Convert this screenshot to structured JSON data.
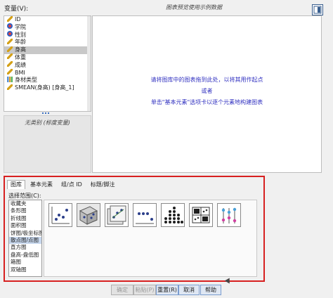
{
  "header": {
    "variables_label": "变量(V):",
    "preview_note": "图表预览使用示例数据"
  },
  "variables": [
    {
      "label": "ID",
      "type": "scale",
      "selected": false
    },
    {
      "label": "学院",
      "type": "nominal",
      "selected": false
    },
    {
      "label": "性别",
      "type": "nominal",
      "selected": false
    },
    {
      "label": "年龄",
      "type": "scale",
      "selected": false
    },
    {
      "label": "身高",
      "type": "scale",
      "selected": true
    },
    {
      "label": "体重",
      "type": "scale",
      "selected": false
    },
    {
      "label": "成绩",
      "type": "scale",
      "selected": false
    },
    {
      "label": "BMI",
      "type": "scale",
      "selected": false
    },
    {
      "label": "身材类型",
      "type": "ordinal",
      "selected": false
    },
    {
      "label": "SMEAN(身高) [身高_1]",
      "type": "scale",
      "selected": false
    }
  ],
  "groups_box": {
    "text": "无类别 (标度变量)"
  },
  "canvas": {
    "line1": "请将图库中的图表拖到此处，以将其用作起点",
    "line2": "或者",
    "line3": "单击\"基本元素\"选项卡以逐个元素地构建图表"
  },
  "tabs": [
    {
      "label": "图库",
      "active": true
    },
    {
      "label": "基本元素",
      "active": false
    },
    {
      "label": "组/点 ID",
      "active": false
    },
    {
      "label": "标题/脚注",
      "active": false
    }
  ],
  "gallery": {
    "choose_label": "选择范围(C):",
    "chart_types": [
      {
        "label": "收藏夹",
        "selected": false
      },
      {
        "label": "条形图",
        "selected": false
      },
      {
        "label": "折线图",
        "selected": false
      },
      {
        "label": "面积图",
        "selected": false
      },
      {
        "label": "饼图/极坐标图",
        "selected": false
      },
      {
        "label": "散点图/点图",
        "selected": true
      },
      {
        "label": "直方图",
        "selected": false
      },
      {
        "label": "盘高-盘低图",
        "selected": false
      },
      {
        "label": "箱图",
        "selected": false
      },
      {
        "label": "双轴图",
        "selected": false
      }
    ],
    "thumbnails": [
      {
        "icon": "simple-scatter-icon",
        "selected": false
      },
      {
        "icon": "3d-scatter-icon",
        "selected": false
      },
      {
        "icon": "grouped-scatter-icon",
        "selected": false
      },
      {
        "icon": "simple-dot-plot-icon",
        "selected": false
      },
      {
        "icon": "dot-stack-icon",
        "selected": false
      },
      {
        "icon": "scatter-matrix-icon",
        "selected": false
      },
      {
        "icon": "drop-line-icon",
        "selected": false
      }
    ]
  },
  "buttons": [
    {
      "label": "确定",
      "enabled": false
    },
    {
      "label": "粘贴(P)",
      "enabled": false
    },
    {
      "label": "重置(R)",
      "enabled": true
    },
    {
      "label": "取消",
      "enabled": true
    },
    {
      "label": "帮助",
      "enabled": true
    }
  ],
  "colors": {
    "highlight_box": "#d72020",
    "hint_text": "#3030c0",
    "selected_row": "#c8c8c8"
  }
}
